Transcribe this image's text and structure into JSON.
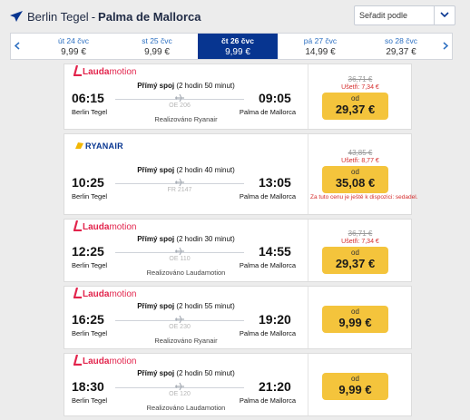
{
  "header": {
    "origin": "Berlin Tegel",
    "separator": "-",
    "destination": "Palma de Mallorca",
    "sort_label": "Seřadit podle",
    "accent_color": "#073590",
    "icons": {
      "plane": "airplane-icon",
      "sort": "chevron-down-icon"
    }
  },
  "dates": [
    {
      "day": "út 24 čvc",
      "price": "9,99 €"
    },
    {
      "day": "st 25 čvc",
      "price": "9,99 €"
    },
    {
      "day": "čt 26 čvc",
      "price": "9,99 €",
      "active": true
    },
    {
      "day": "pá 27 čvc",
      "price": "14,99 €"
    },
    {
      "day": "so 28 čvc",
      "price": "29,37 €"
    }
  ],
  "flights": [
    {
      "airline": "Laudamotion",
      "logo": "laudamotion",
      "logo_part1": "Lauda",
      "logo_part2": "motion",
      "direct": "Přímý spoj",
      "duration": "(2 hodin 50 minut)",
      "dep_time": "06:15",
      "dep_city": "Berlin Tegel",
      "arr_time": "09:05",
      "arr_city": "Palma de Mallorca",
      "flight_no": "OE 206",
      "operated": "Realizováno Ryanair",
      "old_price": "36,71 €",
      "saving": "Ušetři: 7,34 €",
      "from": "od",
      "price": "29,37 €"
    },
    {
      "airline": "RYANAIR",
      "logo": "ryanair",
      "direct": "Přímý spoj",
      "duration": "(2 hodin 40 minut)",
      "dep_time": "10:25",
      "dep_city": "Berlin Tegel",
      "arr_time": "13:05",
      "arr_city": "Palma de Mallorca",
      "flight_no": "FR 2147",
      "operated": "",
      "old_price": "43,85 €",
      "saving": "Ušetři: 8,77 €",
      "from": "od",
      "price": "35,08 €",
      "warning": "Za tuto cenu je ještě k dispozici: sedadel."
    },
    {
      "airline": "Laudamotion",
      "logo": "laudamotion",
      "logo_part1": "Lauda",
      "logo_part2": "motion",
      "direct": "Přímý spoj",
      "duration": "(2 hodin 30 minut)",
      "dep_time": "12:25",
      "dep_city": "Berlin Tegel",
      "arr_time": "14:55",
      "arr_city": "Palma de Mallorca",
      "flight_no": "OE 110",
      "operated": "Realizováno Laudamotion",
      "old_price": "36,71 €",
      "saving": "Ušetři: 7,34 €",
      "from": "od",
      "price": "29,37 €"
    },
    {
      "airline": "Laudamotion",
      "logo": "laudamotion",
      "logo_part1": "Lauda",
      "logo_part2": "motion",
      "direct": "Přímý spoj",
      "duration": "(2 hodin 55 minut)",
      "dep_time": "16:25",
      "dep_city": "Berlin Tegel",
      "arr_time": "19:20",
      "arr_city": "Palma de Mallorca",
      "flight_no": "OE 230",
      "operated": "Realizováno Ryanair",
      "from": "od",
      "price": "9,99 €"
    },
    {
      "airline": "Laudamotion",
      "logo": "laudamotion",
      "logo_part1": "Lauda",
      "logo_part2": "motion",
      "direct": "Přímý spoj",
      "duration": "(2 hodin 50 minut)",
      "dep_time": "18:30",
      "dep_city": "Berlin Tegel",
      "arr_time": "21:20",
      "arr_city": "Palma de Mallorca",
      "flight_no": "OE 120",
      "operated": "Realizováno Laudamotion",
      "from": "od",
      "price": "9,99 €"
    }
  ]
}
